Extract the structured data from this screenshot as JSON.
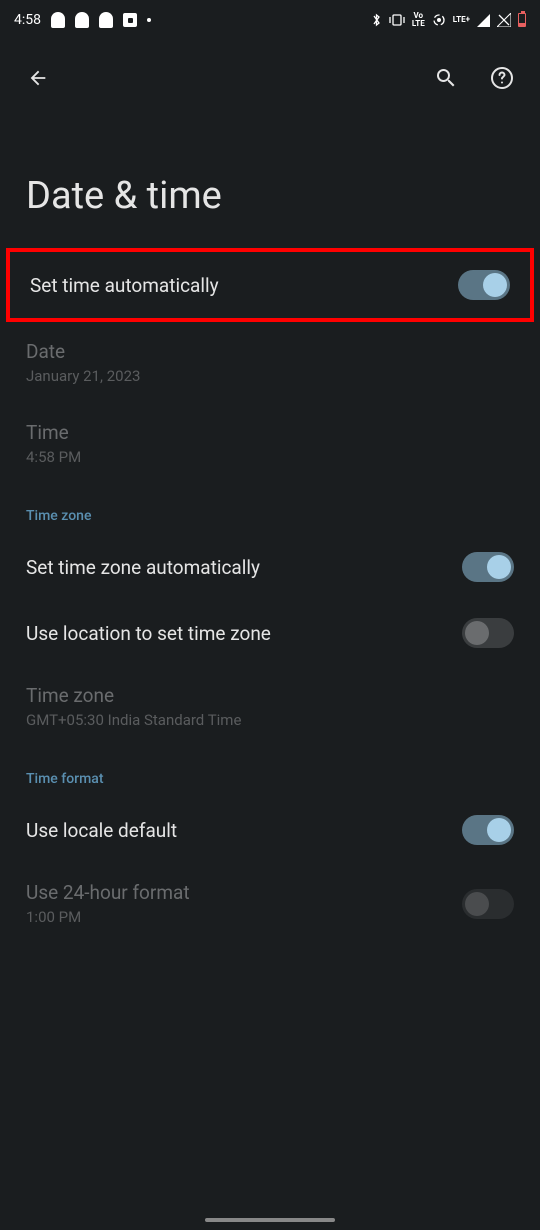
{
  "statusBar": {
    "time": "4:58",
    "voLabel": "Vo",
    "lteLabel": "LTE",
    "ltePlusLabel": "LTE+"
  },
  "pageTitle": "Date & time",
  "settings": {
    "setTimeAuto": {
      "label": "Set time automatically"
    },
    "date": {
      "label": "Date",
      "value": "January 21, 2023"
    },
    "time": {
      "label": "Time",
      "value": "4:58 PM"
    },
    "timezoneHeader": "Time zone",
    "setTimezoneAuto": {
      "label": "Set time zone automatically"
    },
    "useLocation": {
      "label": "Use location to set time zone"
    },
    "timezone": {
      "label": "Time zone",
      "value": "GMT+05:30 India Standard Time"
    },
    "timeFormatHeader": "Time format",
    "useLocale": {
      "label": "Use locale default"
    },
    "use24h": {
      "label": "Use 24-hour format",
      "value": "1:00 PM"
    }
  }
}
